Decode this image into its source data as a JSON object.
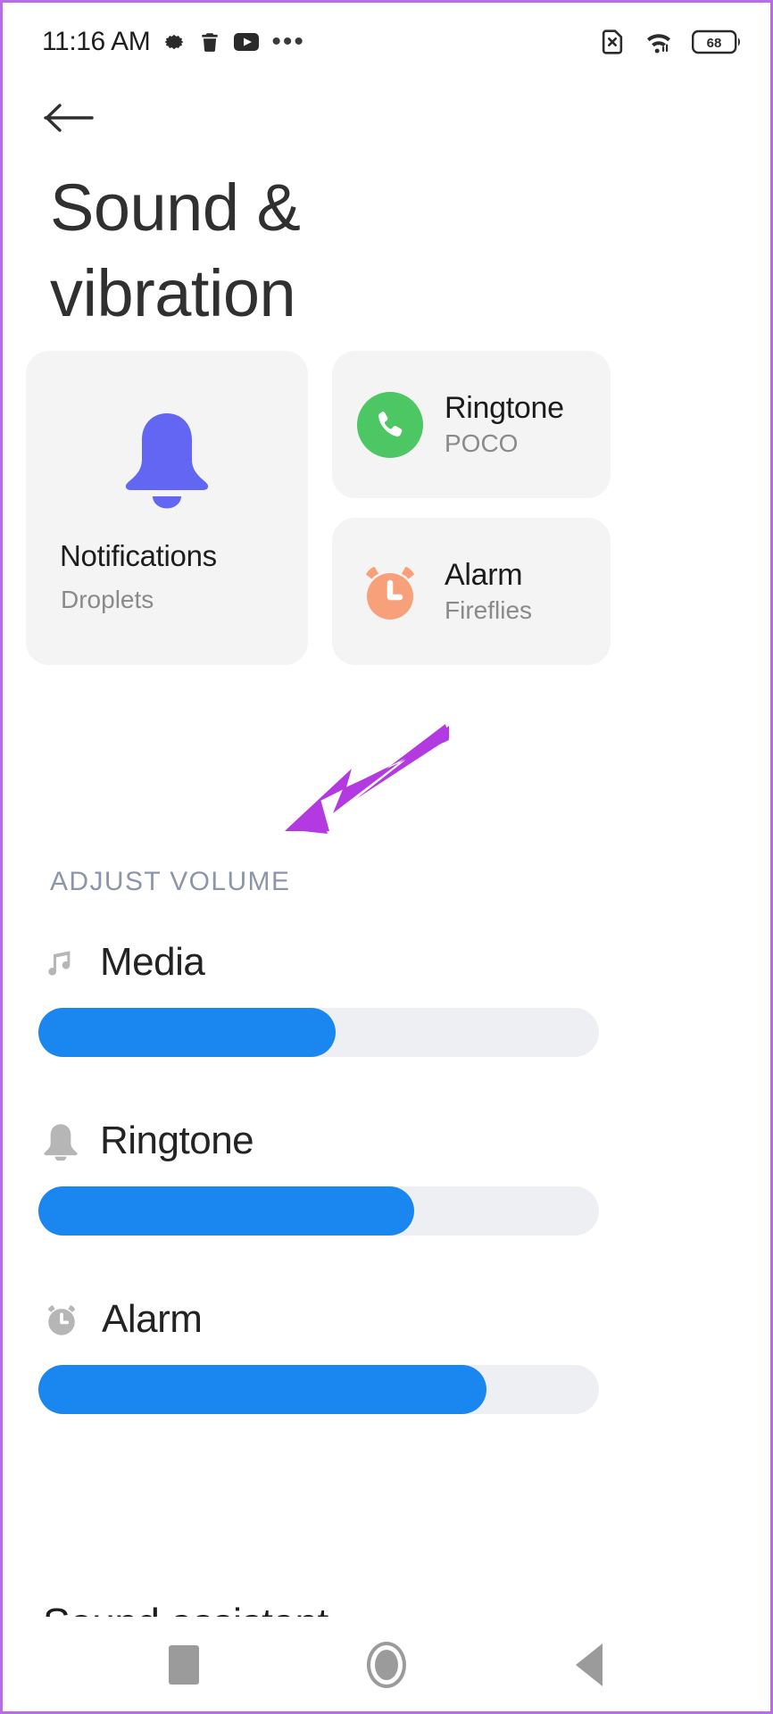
{
  "status_bar": {
    "time": "11:16 AM",
    "left_icons": [
      "gear-icon",
      "trash-icon",
      "youtube-icon",
      "overflow-dots-icon"
    ],
    "overflow": "•••",
    "right_icons": [
      "sim-card-error-icon",
      "wifi-icon",
      "battery-icon"
    ],
    "battery_level": "68"
  },
  "nav": {
    "back_label": "back-arrow"
  },
  "header": {
    "title": "Sound & vibration",
    "title_line1": "Sound &",
    "title_line2": "vibration"
  },
  "cards": {
    "notifications": {
      "title": "Notifications",
      "subtitle": "Droplets",
      "icon": "bell-icon",
      "icon_color": "#6366f2"
    },
    "ringtone": {
      "title": "Ringtone",
      "subtitle": "POCO",
      "icon": "phone-icon",
      "icon_color": "#4cc764"
    },
    "alarm": {
      "title": "Alarm",
      "subtitle": "Fireflies",
      "icon": "alarm-clock-icon",
      "icon_color": "#f7a079"
    }
  },
  "adjust_volume": {
    "section_label": "ADJUST VOLUME",
    "section_label_color": "#8d95a8",
    "slider_track_color": "#edeff2",
    "slider_fill_color": "#1a86f0",
    "rows": [
      {
        "label": "Media",
        "icon": "music-note-icon",
        "value_percent": 53
      },
      {
        "label": "Ringtone",
        "icon": "bell-icon",
        "value_percent": 67
      },
      {
        "label": "Alarm",
        "icon": "alarm-clock-icon",
        "value_percent": 80
      }
    ]
  },
  "sound_assistant": {
    "label": "Sound assistant"
  },
  "bottom_nav": {
    "recents": "recents-square",
    "home": "home-circle",
    "back": "back-triangle"
  },
  "annotation": {
    "arrow_color": "#b23ae0",
    "points_to": "media-volume-slider"
  }
}
